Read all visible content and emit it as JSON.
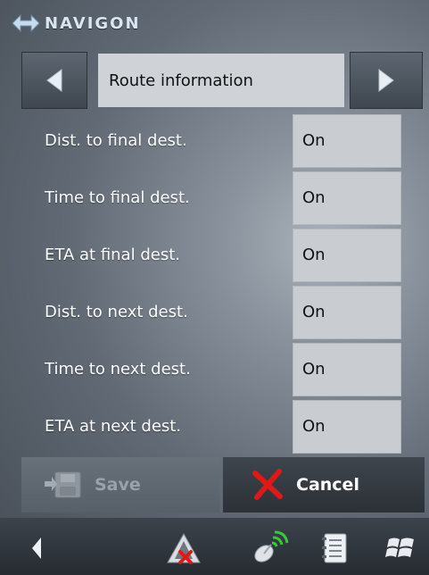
{
  "brand": {
    "name": "NAVIGON"
  },
  "header": {
    "title": "Route information",
    "prev_icon": "triangle-left-icon",
    "next_icon": "triangle-right-icon"
  },
  "settings": [
    {
      "label": "Dist. to final dest.",
      "value": "On"
    },
    {
      "label": "Time to final dest.",
      "value": "On"
    },
    {
      "label": "ETA at final dest.",
      "value": "On"
    },
    {
      "label": "Dist. to next dest.",
      "value": "On"
    },
    {
      "label": "Time to next dest.",
      "value": "On"
    },
    {
      "label": "ETA at next dest.",
      "value": "On"
    }
  ],
  "actions": {
    "save_label": "Save",
    "cancel_label": "Cancel"
  },
  "bottom_bar": {
    "items": [
      "back-icon",
      "no-gps-warning-icon",
      "gps-signal-icon",
      "notebook-icon",
      "windows-icon"
    ]
  },
  "colors": {
    "value_box": "#c9cdd2",
    "cancel_x": "#e01818",
    "gps_green": "#38c838"
  }
}
